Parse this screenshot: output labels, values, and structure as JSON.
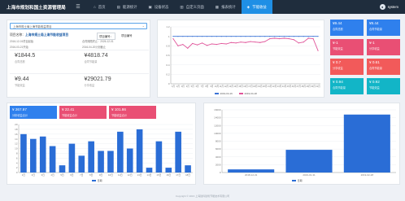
{
  "app_title": "上海市规划和国土资源管理局",
  "nav": [
    {
      "icon": "home-icon",
      "glyph": "⌂",
      "label": "首页"
    },
    {
      "icon": "chart-icon",
      "glyph": "▤",
      "label": "能源统计"
    },
    {
      "icon": "monitor-icon",
      "glyph": "▣",
      "label": "设备状态"
    },
    {
      "icon": "book-icon",
      "glyph": "▥",
      "label": "自定义页面"
    },
    {
      "icon": "report-icon",
      "glyph": "▦",
      "label": "报表统计"
    },
    {
      "icon": "leaf-icon",
      "glyph": "◈",
      "label": "节能收益"
    }
  ],
  "user": {
    "name": "system",
    "avatar": "●"
  },
  "project": {
    "search_value": "上海市规土局上海节能收益项目",
    "label": "项目名称：",
    "name": "上海市规土局上海节能收益项目",
    "button": "项目编号：",
    "code": "项目编号",
    "meta": [
      "2016-12-01项目起始",
      "合同期限终止：2026-12-01",
      "2016-03-21开始",
      "2016-04-20计划截止"
    ],
    "stats": [
      {
        "value": "¥1844.5",
        "caption": "合同总额"
      },
      {
        "value": "¥4818.74",
        "caption": "合同节能量"
      },
      {
        "value": "¥9.44",
        "caption": "节能效益"
      },
      {
        "value": "¥29021.79",
        "caption": "分享收益"
      }
    ]
  },
  "tiles": [
    {
      "value": "¥9.44",
      "caption": "合同总额",
      "color": "#2f80ed"
    },
    {
      "value": "¥9.44",
      "caption": "合同节能量",
      "color": "#2f80ed"
    },
    {
      "value": "¥-1",
      "caption": "节能效益",
      "color": "#e94f74"
    },
    {
      "value": "¥-1",
      "caption": "分享收益",
      "color": "#e94f74"
    },
    {
      "value": "¥ 0.7",
      "caption": "分享收益",
      "color": "#f25a5a"
    },
    {
      "value": "¥ 0.61",
      "caption": "合同节能量",
      "color": "#f25a5a"
    },
    {
      "value": "¥ 0.94",
      "caption": "合同节能量",
      "color": "#12b5c7"
    },
    {
      "value": "¥ 0.92",
      "caption": "节能效益",
      "color": "#12b5c7"
    }
  ],
  "mini_tiles": [
    {
      "value": "¥ 267.97",
      "caption": "分析收益合计",
      "color": "#2f80ed"
    },
    {
      "value": "¥ 22.41",
      "caption": "节能收益合计",
      "color": "#e94f74"
    },
    {
      "value": "¥ 101.86",
      "caption": "节能收益合计",
      "color": "#e94f74"
    }
  ],
  "footer": "Copyright © 2016 上海建科建筑节能技术有限公司",
  "chart_data": [
    {
      "type": "line",
      "categories": [
        "1月",
        "2月",
        "3月",
        "4月",
        "5月",
        "6月",
        "7月",
        "8月",
        "9月",
        "10月",
        "11月",
        "12月",
        "13月",
        "14月",
        "15月",
        "16月",
        "17月",
        "18月",
        "19月",
        "20月",
        "21月",
        "22月",
        "23月",
        "24月",
        "25月",
        "26月",
        "27月",
        "28月",
        "29月",
        "30月",
        "31月"
      ],
      "ylim": [
        0,
        1.2
      ],
      "yticks": [
        0,
        0.2,
        0.4,
        0.6,
        0.8,
        1,
        1.2
      ],
      "series": [
        {
          "name": "2019-04-16",
          "color": "#3b73d6",
          "values": [
            1.0,
            1.0,
            1.0,
            1.0,
            1.0,
            1.0,
            1.0,
            1.0,
            1.0,
            1.0,
            1.0,
            1.0,
            1.0,
            1.0,
            1.0,
            1.0,
            1.0,
            1.0,
            1.0,
            1.0,
            1.0,
            1.0,
            1.0,
            1.0,
            1.0,
            1.0,
            1.0,
            1.0,
            1.0,
            1.0,
            1.0
          ]
        },
        {
          "name": "2019-04-18",
          "color": "#e0559a",
          "values": [
            0.95,
            0.8,
            0.83,
            0.75,
            0.85,
            0.82,
            0.86,
            0.81,
            0.84,
            0.83,
            0.85,
            0.84,
            0.87,
            0.86,
            0.88,
            0.87,
            0.89,
            0.88,
            0.87,
            0.89,
            0.95,
            0.96,
            0.95,
            0.96,
            0.95,
            0.93,
            0.86,
            0.88,
            0.96,
            0.95,
            0.7
          ]
        }
      ]
    },
    {
      "type": "bar",
      "categories": [
        "1日",
        "2日",
        "3日",
        "4日",
        "5日",
        "6日",
        "7日",
        "8日",
        "9日",
        "10日",
        "11日",
        "12日",
        "13日",
        "14日",
        "15日",
        "16日",
        "17日",
        "18日"
      ],
      "ylim": [
        0,
        20
      ],
      "yticks": [
        0,
        2,
        4,
        6,
        8,
        10,
        12,
        14,
        16,
        18,
        20
      ],
      "series": [
        {
          "name": "日期",
          "color": "#2a6dd6",
          "values": [
            16,
            14,
            15,
            11,
            3,
            12,
            7,
            13,
            9,
            9,
            17,
            10,
            18,
            2,
            13,
            2,
            17,
            3
          ]
        }
      ]
    },
    {
      "type": "bar",
      "categories": [
        "2018-12-31",
        "2019-01-31",
        "2019-02-28"
      ],
      "ylim": [
        0,
        16000
      ],
      "yticks": [
        0,
        2000,
        4000,
        6000,
        8000,
        10000,
        12000,
        14000,
        16000
      ],
      "series": [
        {
          "name": "日期",
          "color": "#2a6dd6",
          "values": [
            800,
            5800,
            14800
          ]
        }
      ]
    }
  ]
}
